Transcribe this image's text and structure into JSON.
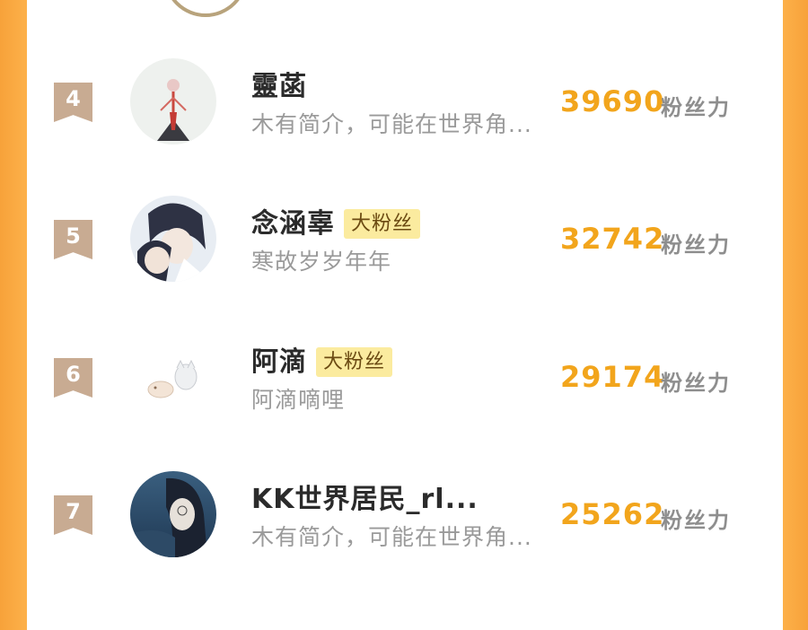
{
  "ranking": [
    {
      "rank": "4",
      "name": "靈菡",
      "badge": "",
      "bio": "木有简介，可能在世界角...",
      "score": "39690",
      "unit": "粉丝力",
      "avatar": "avatar-anatomy-sketch"
    },
    {
      "rank": "5",
      "name": "念涵辜",
      "badge": "大粉丝",
      "bio": "寒故岁岁年年",
      "score": "32742",
      "unit": "粉丝力",
      "avatar": "avatar-anime-couple"
    },
    {
      "rank": "6",
      "name": "阿滴",
      "badge": "大粉丝",
      "bio": "阿滴嘀哩",
      "score": "29174",
      "unit": "粉丝力",
      "avatar": "avatar-cats-sketch"
    },
    {
      "rank": "7",
      "name": "KK世界居民_rl...",
      "badge": "",
      "bio": "木有简介，可能在世界角...",
      "score": "25262",
      "unit": "粉丝力",
      "avatar": "avatar-girl-sea"
    }
  ]
}
